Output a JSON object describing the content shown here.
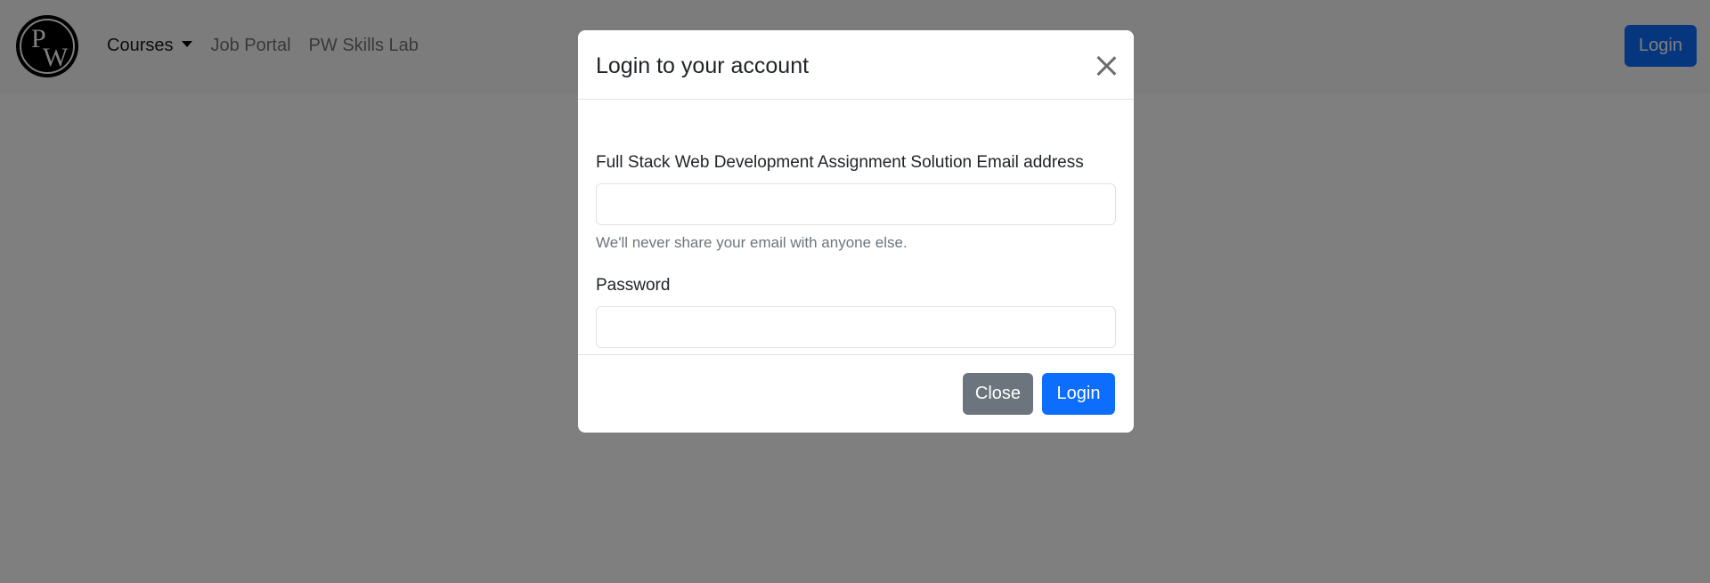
{
  "navbar": {
    "logo_text_p": "P",
    "logo_text_w": "W",
    "links": [
      {
        "label": "Courses"
      },
      {
        "label": "Job Portal"
      },
      {
        "label": "PW Skills Lab"
      }
    ],
    "login_label": "Login"
  },
  "modal": {
    "title": "Login to your account",
    "email_label": "Full Stack Web Development Assignment Solution Email address",
    "email_value": "",
    "email_help": "We'll never share your email with anyone else.",
    "password_label": "Password",
    "password_value": "",
    "close_label": "Close",
    "login_label": "Login"
  },
  "colors": {
    "primary": "#0d6efd",
    "secondary": "#6c757d",
    "backdrop": "rgba(0,0,0,0.5)"
  }
}
